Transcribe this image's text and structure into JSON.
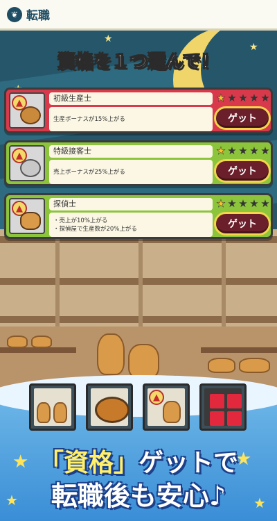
{
  "header": {
    "title": "転職",
    "icon": "leaf-icon"
  },
  "banner": "資格を１つ選んで！",
  "get_label": "ゲット",
  "cards": [
    {
      "name": "初級生産士",
      "desc_lines": [
        "生産ボーナスが15%上がる"
      ],
      "stars": 1,
      "max_stars": 5,
      "color": "#d93a4b",
      "icon": "bread-icon"
    },
    {
      "name": "特級接客士",
      "desc_lines": [
        "売上ボーナスが25%上がる"
      ],
      "stars": 1,
      "max_stars": 5,
      "color": "#8cc43c",
      "icon": "coins-icon"
    },
    {
      "name": "探偵士",
      "desc_lines": [
        "・売上が10%上がる",
        "・探偵屋で生産数が20%上がる"
      ],
      "stars": 1,
      "max_stars": 5,
      "color": "#8cc43c",
      "icon": "detective-icon"
    }
  ],
  "promo_icons": [
    "bakers-icon",
    "dorayaki-icon",
    "king-icon",
    "grid-icon"
  ],
  "catchphrase": {
    "line1_highlight": "「資格」",
    "line1_rest": "ゲットで",
    "line2": "転職後も安心♪"
  }
}
